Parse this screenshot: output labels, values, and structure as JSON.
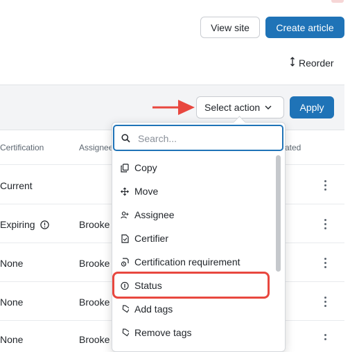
{
  "header": {
    "view_site": "View site",
    "create_article": "Create article",
    "reorder": "Reorder"
  },
  "toolbar": {
    "select_action": "Select action",
    "apply": "Apply"
  },
  "table": {
    "columns": [
      "Certification",
      "Assignee",
      "ated"
    ],
    "rows": [
      {
        "certification": "Current",
        "assignee": ""
      },
      {
        "certification": "Expiring",
        "assignee": "Brooke"
      },
      {
        "certification": "None",
        "assignee": "Brooke"
      },
      {
        "certification": "None",
        "assignee": "Brooke"
      },
      {
        "certification": "None",
        "assignee": "Brooke"
      }
    ]
  },
  "dropdown": {
    "search_placeholder": "Search...",
    "items": [
      {
        "label": "Copy",
        "icon": "copy-icon"
      },
      {
        "label": "Move",
        "icon": "move-icon"
      },
      {
        "label": "Assignee",
        "icon": "assignee-icon"
      },
      {
        "label": "Certifier",
        "icon": "certifier-icon"
      },
      {
        "label": "Certification requirement",
        "icon": "certification-requirement-icon"
      },
      {
        "label": "Status",
        "icon": "status-icon"
      },
      {
        "label": "Add tags",
        "icon": "tag-icon"
      },
      {
        "label": "Remove tags",
        "icon": "tag-icon"
      }
    ]
  },
  "colors": {
    "primary": "#1f73b7",
    "annotation_red": "#e8473f"
  }
}
